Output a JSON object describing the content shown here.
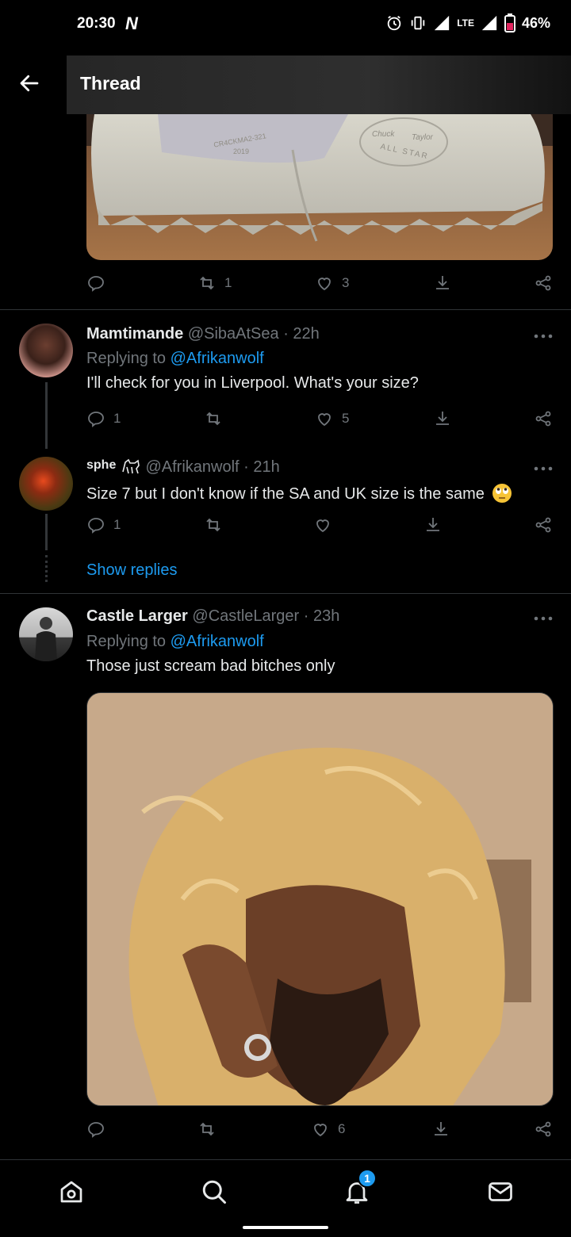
{
  "status_bar": {
    "time": "20:30",
    "battery": "46%",
    "network": "LTE"
  },
  "header": {
    "title": "Thread"
  },
  "top_tweet_actions": {
    "replies": "",
    "retweets": "1",
    "likes": "3"
  },
  "tweets": [
    {
      "name": "Mamtimande",
      "handle": "@SibaAtSea",
      "time": "· 22h",
      "replying_prefix": "Replying to ",
      "replying_to": "@Afrikanwolf",
      "text": "I'll check for you in Liverpool. What's your size?",
      "replies": "1",
      "retweets": "",
      "likes": "5"
    },
    {
      "name": "sphe",
      "handle": "@Afrikanwolf",
      "time": "· 21h",
      "text": "Size 7 but I don't know if the SA and UK size is the same",
      "emoji": "🙄",
      "replies": "1",
      "retweets": "",
      "likes": ""
    },
    {
      "name": "Castle Larger",
      "handle": "@CastleLarger",
      "time": "· 23h",
      "replying_prefix": "Replying to ",
      "replying_to": "@Afrikanwolf",
      "text": "Those just scream bad bitches only",
      "replies": "",
      "retweets": "",
      "likes": "6"
    }
  ],
  "show_replies": "Show replies",
  "shoe_stamp": {
    "line1": "CR4CKMA2-321",
    "line2": "2019",
    "brand_line1": "Chuck",
    "brand_line2": "Taylor",
    "brand_line3": "ALL STAR"
  },
  "nav": {
    "notifications_badge": "1"
  },
  "colors": {
    "accent": "#1d9bf0",
    "muted": "#71767b",
    "text": "#e7e9ea",
    "background": "#000000"
  }
}
